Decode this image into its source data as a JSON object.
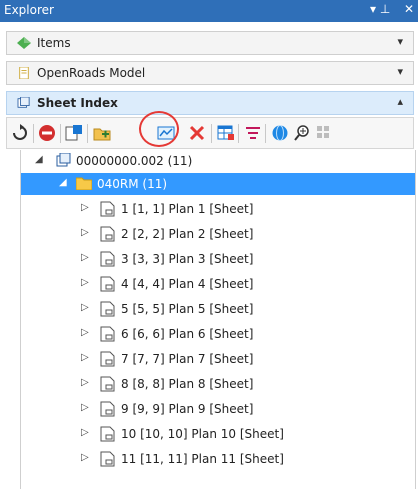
{
  "window": {
    "title": "Explorer",
    "pin_glyph": "▾ ⊥",
    "close_glyph": "✕"
  },
  "panes": [
    {
      "label": "Items",
      "icon": "diamond-icon",
      "state": "collapsed",
      "chevron": "▾"
    },
    {
      "label": "OpenRoads Model",
      "icon": "document-icon",
      "state": "collapsed",
      "chevron": "▾"
    },
    {
      "label": "Sheet Index",
      "icon": "sheet-index-icon",
      "state": "expanded",
      "chevron": "▴"
    }
  ],
  "toolbar": {
    "icons": [
      "refresh-icon",
      "no-entry-icon",
      "sheet-properties-icon",
      "add-folder-icon",
      "add-sheet-icon",
      "delete-icon",
      "table-icon",
      "filter-icon",
      "globe-icon",
      "zoom-icon",
      "grid-icon"
    ],
    "highlighted": "add-sheet-icon"
  },
  "tree": {
    "root": {
      "label": "00000000.002 (11)",
      "expanded": true
    },
    "folder": {
      "label": "040RM (11)",
      "expanded": true,
      "selected": true
    },
    "sheets": [
      "1 [1, 1] Plan 1 [Sheet]",
      "2 [2, 2] Plan 2 [Sheet]",
      "3 [3, 3] Plan 3 [Sheet]",
      "4 [4, 4] Plan 4 [Sheet]",
      "5 [5, 5] Plan 5 [Sheet]",
      "6 [6, 6] Plan 6 [Sheet]",
      "7 [7, 7] Plan 7 [Sheet]",
      "8 [8, 8] Plan 8 [Sheet]",
      "9 [9, 9] Plan 9 [Sheet]",
      "10 [10, 10] Plan 10 [Sheet]",
      "11 [11, 11] Plan 11 [Sheet]"
    ]
  },
  "colors": {
    "accent": "#2f6fb8",
    "selection": "#3399ff",
    "highlight_ring": "#e53935"
  }
}
